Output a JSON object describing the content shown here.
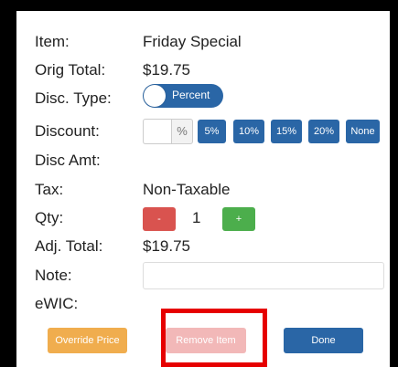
{
  "fields": {
    "item_label": "Item:",
    "item_value": "Friday Special",
    "orig_total_label": "Orig Total:",
    "orig_total_value": "$19.75",
    "disc_type_label": "Disc. Type:",
    "disc_type_toggle": "Percent",
    "discount_label": "Discount:",
    "discount_input_value": "",
    "discount_suffix": "%",
    "discount_options": [
      "5%",
      "10%",
      "15%",
      "20%",
      "None"
    ],
    "disc_amt_label": "Disc Amt:",
    "tax_label": "Tax:",
    "tax_value": "Non-Taxable",
    "qty_label": "Qty:",
    "qty_minus": "-",
    "qty_value": "1",
    "qty_plus": "+",
    "adj_total_label": "Adj. Total:",
    "adj_total_value": "$19.75",
    "note_label": "Note:",
    "note_value": "",
    "ewic_label": "eWIC:"
  },
  "buttons": {
    "override_price": "Override Price",
    "remove_item": "Remove Item",
    "done": "Done"
  },
  "colors": {
    "primary": "#2a66a6",
    "warning": "#f0ad4e",
    "danger_disabled": "#f2b8b8",
    "danger": "#d9534f",
    "success": "#4cae4c",
    "highlight": "#e60000"
  }
}
